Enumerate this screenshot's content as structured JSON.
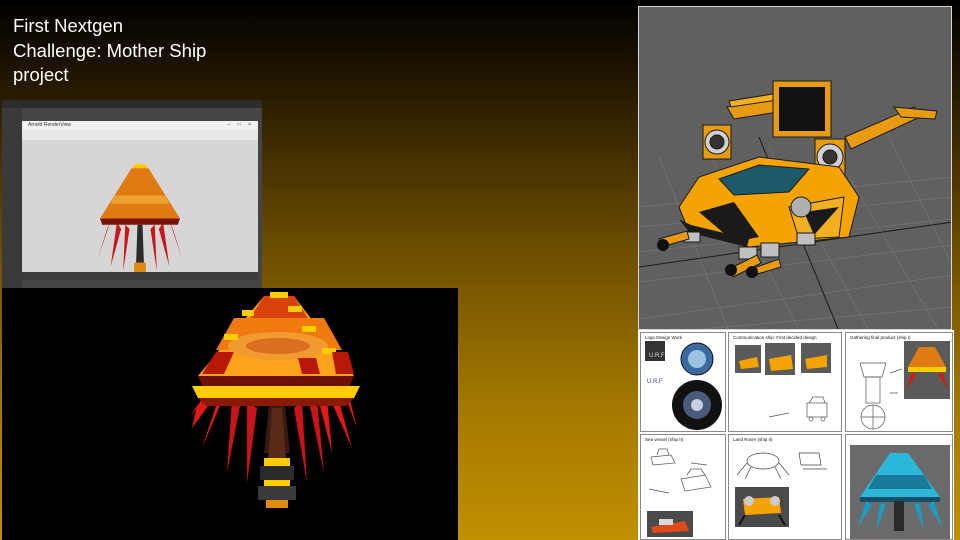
{
  "slide": {
    "title_lines": [
      "First Nextgen",
      "Challenge: Mother Ship",
      "project"
    ]
  },
  "screenshot": {
    "window_title": "Arnold RenderView",
    "window_controls": "– □ ×"
  },
  "board": {
    "cells": [
      {
        "title": "Logo Design Work"
      },
      {
        "title": "Communication ship: First decided design"
      },
      {
        "title": "Gathering final product (ship I)"
      },
      {
        "title": "Sea vessel (ship II)"
      },
      {
        "title": "Land Rover (ship II)"
      },
      {
        "title": ""
      }
    ],
    "logo_text": "U.R.F"
  },
  "colors": {
    "ship_orange": "#e8890c",
    "ship_red": "#d01a0a",
    "ship_yellow": "#ffcc00",
    "rover_orange": "#f5a300",
    "viewport_grey": "#606060"
  }
}
